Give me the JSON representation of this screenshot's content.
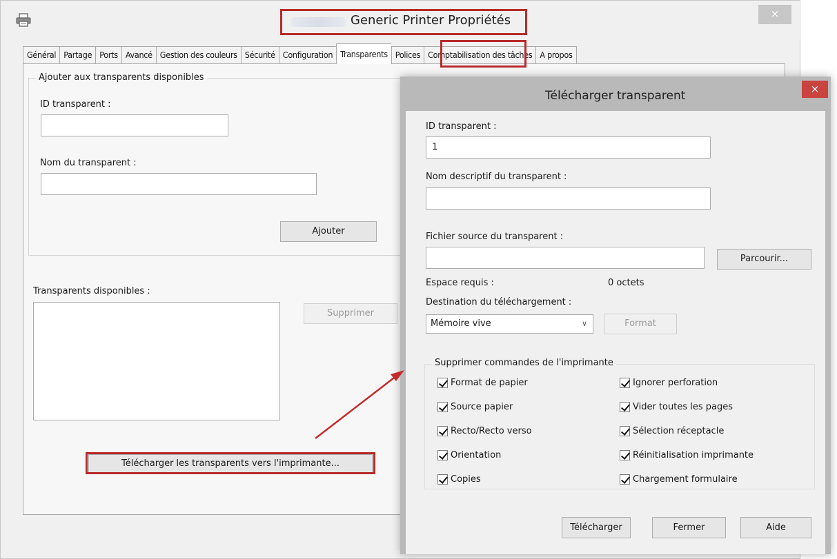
{
  "window": {
    "title": "Generic Printer Propriétés",
    "close_glyph": "×"
  },
  "tabs": [
    {
      "label": "Général"
    },
    {
      "label": "Partage"
    },
    {
      "label": "Ports"
    },
    {
      "label": "Avancé"
    },
    {
      "label": "Gestion des couleurs"
    },
    {
      "label": "Sécurité"
    },
    {
      "label": "Configuration"
    },
    {
      "label": "Transparents",
      "active": true
    },
    {
      "label": "Polices"
    },
    {
      "label": "Comptabilisation des tâches"
    },
    {
      "label": "A propos"
    }
  ],
  "add_group": {
    "title": "Ajouter aux transparents disponibles",
    "id_label": "ID transparent :",
    "id_value": "",
    "name_label": "Nom du transparent :",
    "name_value": "",
    "add_button": "Ajouter"
  },
  "available": {
    "label": "Transparents disponibles :",
    "items": [],
    "delete_button": "Supprimer"
  },
  "download_all_button": "Télécharger les transparents vers l'imprimante...",
  "dialog": {
    "title": "Télécharger transparent",
    "close_glyph": "×",
    "id_label": "ID transparent :",
    "id_value": "1",
    "desc_label": "Nom descriptif du transparent :",
    "desc_value": "",
    "source_label": "Fichier source du transparent :",
    "source_value": "",
    "browse_button": "Parcourir...",
    "space_label": "Espace requis :",
    "space_value": "0  octets",
    "dest_label": "Destination du téléchargement :",
    "dest_value": "Mémoire vive",
    "format_button": "Format",
    "suppress_group": {
      "title": "Supprimer commandes de l'imprimante",
      "left": [
        {
          "label": "Format de papier",
          "checked": true
        },
        {
          "label": "Source papier",
          "checked": true
        },
        {
          "label": "Recto/Recto verso",
          "checked": true
        },
        {
          "label": "Orientation",
          "checked": true
        },
        {
          "label": "Copies",
          "checked": true
        }
      ],
      "right": [
        {
          "label": "Ignorer perforation",
          "checked": true
        },
        {
          "label": "Vider toutes les pages",
          "checked": true
        },
        {
          "label": "Sélection réceptacle",
          "checked": true
        },
        {
          "label": "Réinitialisation imprimante",
          "checked": true
        },
        {
          "label": "Chargement formulaire",
          "checked": true
        }
      ]
    },
    "download_button": "Télécharger",
    "close_button": "Fermer",
    "help_button": "Aide"
  },
  "colors": {
    "highlight": "#b82a2a",
    "dialog_close": "#c9433f"
  },
  "icons": [
    "printer-icon",
    "close-icon",
    "chevron-down-icon",
    "checkmark-icon"
  ]
}
